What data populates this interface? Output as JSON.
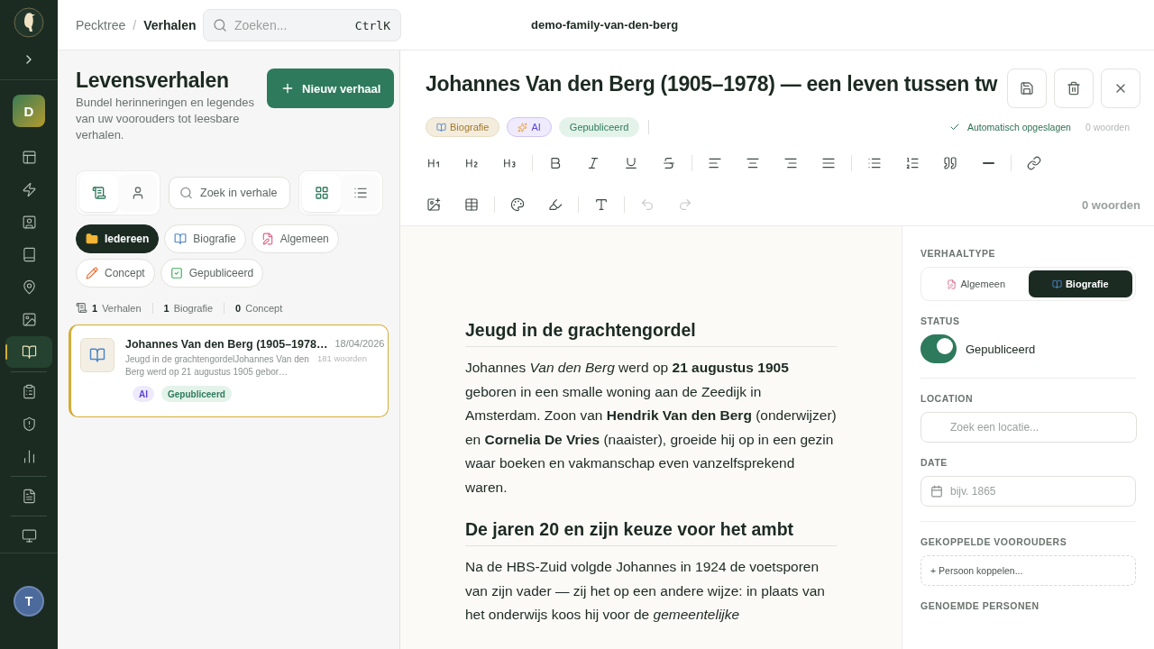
{
  "app_sidebar": {
    "workspace_initial": "D",
    "user_initial": "T",
    "sections": [
      {
        "items": [
          {
            "kind": "layout",
            "selected": false
          },
          {
            "kind": "zap",
            "selected": false
          },
          {
            "kind": "contact",
            "selected": false
          },
          {
            "kind": "book",
            "selected": false
          },
          {
            "kind": "pin",
            "selected": false
          },
          {
            "kind": "image",
            "selected": false
          },
          {
            "kind": "story",
            "selected": true
          }
        ]
      },
      {
        "items": [
          {
            "kind": "clipboard",
            "selected": false
          },
          {
            "kind": "shield",
            "selected": false
          },
          {
            "kind": "chart",
            "selected": false
          }
        ]
      },
      {
        "items": [
          {
            "kind": "file",
            "selected": false
          }
        ]
      },
      {
        "items": [
          {
            "kind": "monitor",
            "selected": false
          }
        ]
      }
    ]
  },
  "topbar": {
    "breadcrumb": [
      "Pecktree",
      "Verhalen"
    ],
    "separator": "/",
    "search": {
      "placeholder": "Zoeken...",
      "shortcut": "CtrlK"
    },
    "workspace": "demo-family-van-den-berg"
  },
  "list_panel": {
    "title": "Levensverhalen",
    "subtitle": "Bundel herinneringen en legendes van uw voorouders tot leesbare verhalen.",
    "new_button": "Nieuw verhaal",
    "view_toggle": [
      {
        "kind": "scroll",
        "selected": true
      },
      {
        "kind": "person",
        "selected": false
      }
    ],
    "search": {
      "placeholder": "Zoek in verhale"
    },
    "layout_toggle": [
      {
        "kind": "grid",
        "selected": true
      },
      {
        "kind": "list",
        "selected": false
      }
    ],
    "filters": [
      {
        "label": "Iedereen",
        "kind": "folder",
        "selected": true
      },
      {
        "label": "Biografie",
        "kind": "book",
        "selected": false
      },
      {
        "label": "Algemeen",
        "kind": "memo",
        "selected": false
      },
      {
        "label": "Concept",
        "kind": "pencil",
        "selected": false
      },
      {
        "label": "Gepubliceerd",
        "kind": "check",
        "selected": false
      }
    ],
    "stats": [
      {
        "count": "1",
        "label": "Verhalen"
      },
      {
        "count": "1",
        "label": "Biografie"
      },
      {
        "count": "0",
        "label": "Concept"
      }
    ],
    "stories": [
      {
        "title": "Johannes Van den Berg (1905–1978…",
        "date": "18/04/2026",
        "excerpt": "Jeugd in de grachtengordelJohannes Van den Berg werd op 21 augustus 1905 gebor…",
        "words": "181 woorden",
        "selected": true,
        "tags": [
          {
            "label": "AI",
            "kind": "ai"
          },
          {
            "label": "Gepubliceerd",
            "kind": "status"
          }
        ]
      }
    ]
  },
  "editor": {
    "title": "Johannes Van den Berg (1905–1978) — een leven tussen tw",
    "tags": [
      {
        "label": "Biografie",
        "kind": "type"
      },
      {
        "label": "AI",
        "kind": "ai"
      },
      {
        "label": "Gepubliceerd",
        "kind": "status"
      }
    ],
    "autosave": "Automatisch opgeslagen",
    "word_count": "0 woorden",
    "toolbar": {
      "rows": [
        {
          "groups": [
            {
              "items": [
                {
                  "kind": "h1",
                  "disabled": false
                },
                {
                  "kind": "h2",
                  "disabled": false
                },
                {
                  "kind": "h3",
                  "disabled": false
                }
              ]
            },
            {
              "items": [
                {
                  "kind": "bold",
                  "disabled": false
                },
                {
                  "kind": "italic",
                  "disabled": false
                },
                {
                  "kind": "underline",
                  "disabled": false
                },
                {
                  "kind": "strike",
                  "disabled": false
                }
              ]
            },
            {
              "items": [
                {
                  "kind": "align-left",
                  "disabled": false
                },
                {
                  "kind": "align-center",
                  "disabled": false
                },
                {
                  "kind": "align-right",
                  "disabled": false
                },
                {
                  "kind": "justify",
                  "disabled": false
                }
              ]
            },
            {
              "items": [
                {
                  "kind": "bullets",
                  "disabled": false
                },
                {
                  "kind": "numbers",
                  "disabled": false
                },
                {
                  "kind": "quote",
                  "disabled": false
                },
                {
                  "kind": "rule",
                  "disabled": false
                }
              ]
            },
            {
              "items": [
                {
                  "kind": "link",
                  "disabled": false
                }
              ]
            }
          ]
        },
        {
          "groups": [
            {
              "items": [
                {
                  "kind": "image",
                  "disabled": false
                },
                {
                  "kind": "table",
                  "disabled": false
                }
              ]
            },
            {
              "items": [
                {
                  "kind": "palette",
                  "disabled": false
                },
                {
                  "kind": "highlight",
                  "disabled": false
                }
              ]
            },
            {
              "items": [
                {
                  "kind": "text",
                  "disabled": false
                }
              ]
            },
            {
              "items": [
                {
                  "kind": "undo",
                  "disabled": true
                },
                {
                  "kind": "redo",
                  "disabled": true
                }
              ]
            }
          ],
          "word_count": "0 woorden"
        }
      ]
    },
    "blocks": [
      {
        "kind": "heading",
        "text": "Jeugd in de grachtengordel"
      },
      {
        "kind": "paragraph",
        "text": "Johannes *Van den Berg* werd op **21 augustus 1905** geboren in een smalle woning aan de Zeedijk in Amsterdam. Zoon van **Hendrik Van den Berg** (onderwijzer) en **Cornelia De Vries** (naaister), groeide hij op in een gezin waar boeken en vakmanschap even vanzelfsprekend waren."
      },
      {
        "kind": "heading",
        "text": "De jaren 20 en zijn keuze voor het ambt"
      },
      {
        "kind": "paragraph",
        "text": "Na de HBS-Zuid volgde Johannes in 1924 de voetsporen van zijn vader — zij het op een andere wijze: in plaats van het onderwijs koos hij voor de *gemeentelijke*"
      }
    ]
  },
  "details": {
    "story_type": {
      "label": "VERHAALTYPE",
      "options": [
        {
          "label": "Algemeen",
          "kind": "memo",
          "selected": false
        },
        {
          "label": "Biografie",
          "kind": "book",
          "selected": true
        }
      ]
    },
    "status": {
      "label": "STATUS",
      "on": true,
      "text": "Gepubliceerd"
    },
    "location": {
      "label": "LOCATION",
      "placeholder": "Zoek een locatie..."
    },
    "date": {
      "label": "DATE",
      "placeholder": "bijv. 1865"
    },
    "ancestors": {
      "label": "GEKOPPELDE VOOROUDERS",
      "button": "+ Persoon koppelen..."
    },
    "mentioned": {
      "label": "GENOEMDE PERSONEN"
    }
  }
}
